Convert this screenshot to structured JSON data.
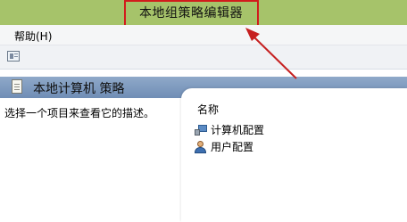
{
  "window": {
    "title": "本地组策略编辑器"
  },
  "menu": {
    "help_label": "帮助(H)"
  },
  "toolbar": {
    "icons": [
      "show-hide-pane-icon"
    ]
  },
  "policy_header": {
    "title": "本地计算机 策略",
    "icon": "policy-document-icon"
  },
  "left_pane": {
    "description_hint": "选择一个项目来查看它的描述。"
  },
  "right_pane": {
    "column_header": "名称",
    "items": [
      {
        "label": "计算机配置",
        "icon": "computer-icon"
      },
      {
        "label": "用户配置",
        "icon": "user-icon"
      }
    ]
  },
  "colors": {
    "titlebar": "#a6c36a",
    "highlight": "#d11c1c",
    "header_band": "#7f9bc0"
  }
}
